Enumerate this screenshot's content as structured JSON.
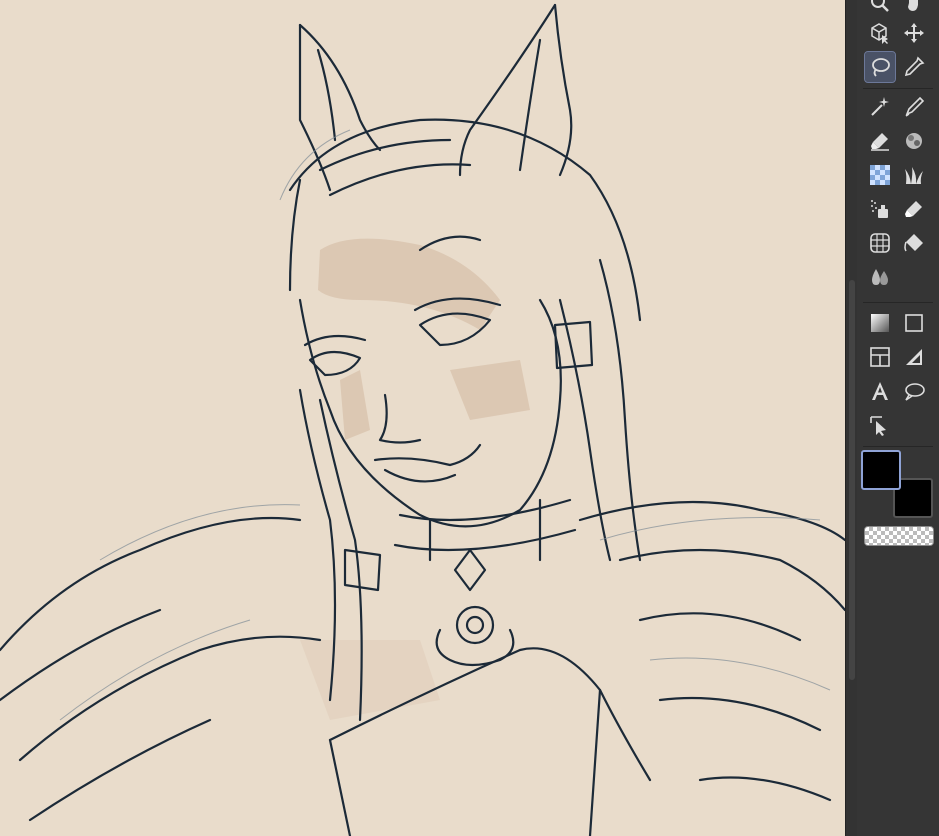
{
  "app": {
    "canvas_background": "#e9dccb",
    "ink_color": "#1c2a38",
    "sketch_color": "#c2a58c"
  },
  "toolbar": {
    "tools": [
      {
        "name": "zoom",
        "icon": "magnifier-icon"
      },
      {
        "name": "hand",
        "icon": "hand-icon"
      },
      {
        "name": "object-select",
        "icon": "3d-cube-cursor-icon"
      },
      {
        "name": "move",
        "icon": "move-arrows-icon"
      },
      {
        "name": "lasso-selection",
        "icon": "lasso-icon",
        "active": true
      },
      {
        "name": "eyedropper",
        "icon": "eyedropper-icon"
      },
      {
        "name": "magic-wand",
        "icon": "magic-wand-icon"
      },
      {
        "name": "pen",
        "icon": "pen-nib-icon"
      },
      {
        "name": "eraser",
        "icon": "eraser-icon"
      },
      {
        "name": "texture-brush",
        "icon": "brush-blob-icon"
      },
      {
        "name": "pattern-fill",
        "icon": "checker-pattern-icon"
      },
      {
        "name": "grass-brush",
        "icon": "grass-icon"
      },
      {
        "name": "airbrush",
        "icon": "airbrush-icon"
      },
      {
        "name": "eraser-alt",
        "icon": "eraser-alt-icon"
      },
      {
        "name": "perspective-ruler",
        "icon": "perspective-grid-icon"
      },
      {
        "name": "fill",
        "icon": "paint-bucket-icon"
      },
      {
        "name": "blend",
        "icon": "water-drops-icon"
      },
      {
        "name": "gradient",
        "icon": "gradient-icon"
      },
      {
        "name": "figure",
        "icon": "rectangle-icon"
      },
      {
        "name": "frame-border",
        "icon": "panel-layout-icon"
      },
      {
        "name": "ruler",
        "icon": "triangle-ruler-icon"
      },
      {
        "name": "text",
        "icon": "text-icon"
      },
      {
        "name": "balloon",
        "icon": "speech-balloon-icon"
      },
      {
        "name": "operation",
        "icon": "operation-cursor-icon"
      }
    ],
    "main_color": "#000000",
    "sub_color": "#000000"
  }
}
